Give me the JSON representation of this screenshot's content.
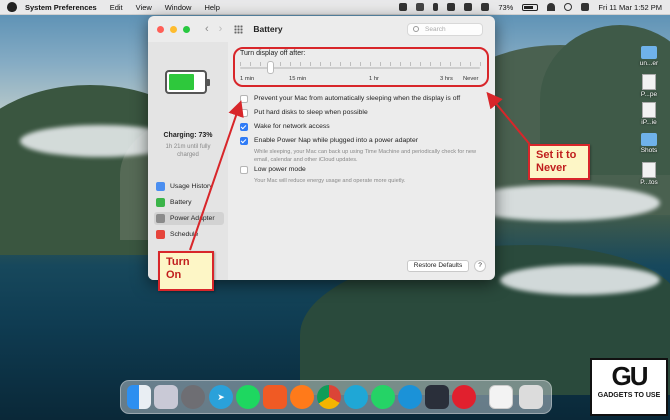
{
  "menubar": {
    "app": "System Preferences",
    "items": [
      "Edit",
      "View",
      "Window",
      "Help"
    ],
    "battery_percent": "73%",
    "clock": "Fri 11 Mar  1:52 PM"
  },
  "desktop_icons": [
    "un...er",
    "P...pe",
    "iP...ie",
    "Shots",
    "P...tos"
  ],
  "window": {
    "title": "Battery",
    "search_placeholder": "Search",
    "sidebar": {
      "battery_level": 0.73,
      "charging_label": "Charging: 73%",
      "charging_sub": "1h 21m until fully charged",
      "items": [
        {
          "label": "Usage History",
          "color": "#4a8ef0"
        },
        {
          "label": "Battery",
          "color": "#3bb449"
        },
        {
          "label": "Power Adapter",
          "color": "#8b8b8b"
        },
        {
          "label": "Schedule",
          "color": "#e6453c"
        }
      ],
      "selected": "Power Adapter"
    },
    "slider": {
      "label": "Turn display off after:",
      "tick_labels": [
        "1 min",
        "15 min",
        "1 hr",
        "3 hrs",
        "Never"
      ]
    },
    "options": [
      {
        "label": "Prevent your Mac from automatically sleeping when the display is off",
        "checked": false
      },
      {
        "label": "Put hard disks to sleep when possible",
        "checked": false
      },
      {
        "label": "Wake for network access",
        "checked": true
      },
      {
        "label": "Enable Power Nap while plugged into a power adapter",
        "checked": true,
        "description": "While sleeping, your Mac can back up using Time Machine and periodically check for new email, calendar and other iCloud updates."
      },
      {
        "label": "Low power mode",
        "checked": false,
        "description": "Your Mac will reduce energy usage and operate more quietly."
      }
    ],
    "restore_button": "Restore Defaults",
    "help_button": "?"
  },
  "annotations": {
    "right_note": "Set it to Never",
    "left_note": "Turn On",
    "color": "#d8262a"
  },
  "dock_apps": [
    "finder-icon",
    "launchpad-icon",
    "system-preferences-icon",
    "telegram-icon",
    "spotify-icon",
    "brave-icon",
    "firefox-icon",
    "chrome-icon",
    "edge-icon",
    "whatsapp-icon",
    "opera-icon",
    "steam-icon",
    "opera-gx-icon",
    "mail-icon",
    "trash-icon"
  ],
  "watermark": {
    "mark": "GU",
    "text": "GADGETS TO USE"
  }
}
